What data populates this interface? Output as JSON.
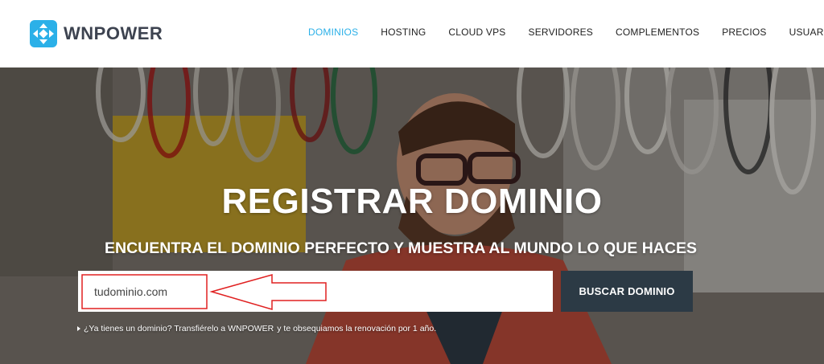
{
  "brand": {
    "name": "WNPOWER",
    "accent": "#2bb0e8",
    "icon": "wnpower-logo-icon"
  },
  "nav": {
    "items": [
      {
        "label": "DOMINIOS",
        "active": true
      },
      {
        "label": "HOSTING",
        "active": false
      },
      {
        "label": "CLOUD VPS",
        "active": false
      },
      {
        "label": "SERVIDORES",
        "active": false
      },
      {
        "label": "COMPLEMENTOS",
        "active": false
      },
      {
        "label": "PRECIOS",
        "active": false
      },
      {
        "label": "USUARIOS",
        "active": false
      }
    ]
  },
  "hero": {
    "title": "REGISTRAR DOMINIO",
    "subtitle": "ENCUENTRA EL DOMINIO PERFECTO Y MUESTRA AL MUNDO LO QUE HACES"
  },
  "search": {
    "value": "tudominio.com",
    "button_label": "BUSCAR DOMINIO",
    "button_color": "#2c3a45"
  },
  "transfer": {
    "prefix": "¿Ya tienes un dominio? Transfiérelo a",
    "link": "WNPOWER",
    "suffix": "y te obsequiamos la renovación por 1 año."
  },
  "annotation": {
    "color": "#e02020"
  }
}
